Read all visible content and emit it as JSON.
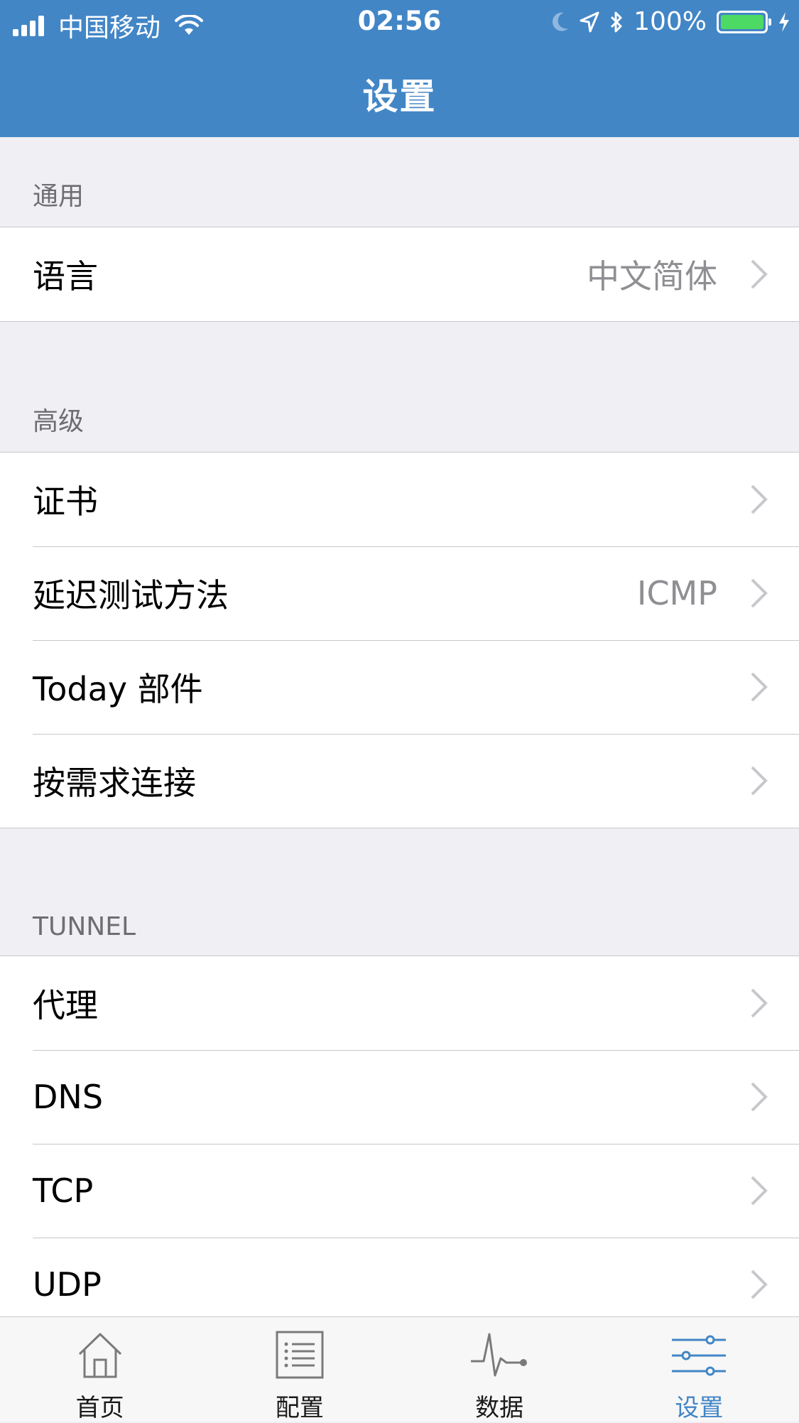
{
  "status_bar": {
    "carrier": "中国移动",
    "time": "02:56",
    "battery": "100%",
    "battery_level": 1.0
  },
  "nav": {
    "title": "设置"
  },
  "sections": {
    "general": {
      "header": "通用",
      "rows": [
        {
          "label": "语言",
          "value": "中文简体"
        }
      ]
    },
    "advanced": {
      "header": "高级",
      "rows": [
        {
          "label": "证书",
          "value": ""
        },
        {
          "label": "延迟测试方法",
          "value": "ICMP"
        },
        {
          "label": "Today 部件",
          "value": ""
        },
        {
          "label": "按需求连接",
          "value": ""
        }
      ]
    },
    "tunnel": {
      "header": "TUNNEL",
      "rows": [
        {
          "label": "代理"
        },
        {
          "label": "DNS"
        },
        {
          "label": "TCP"
        },
        {
          "label": "UDP"
        }
      ]
    }
  },
  "tabbar": {
    "items": [
      {
        "label": "首页",
        "icon": "home-icon"
      },
      {
        "label": "配置",
        "icon": "list-icon"
      },
      {
        "label": "数据",
        "icon": "pulse-icon"
      },
      {
        "label": "设置",
        "icon": "sliders-icon"
      }
    ],
    "active_index": 3
  },
  "colors": {
    "accent": "#4286c6",
    "background": "#efeff4",
    "secondary_text": "#8e8e93",
    "battery_fill": "#4cd964"
  }
}
